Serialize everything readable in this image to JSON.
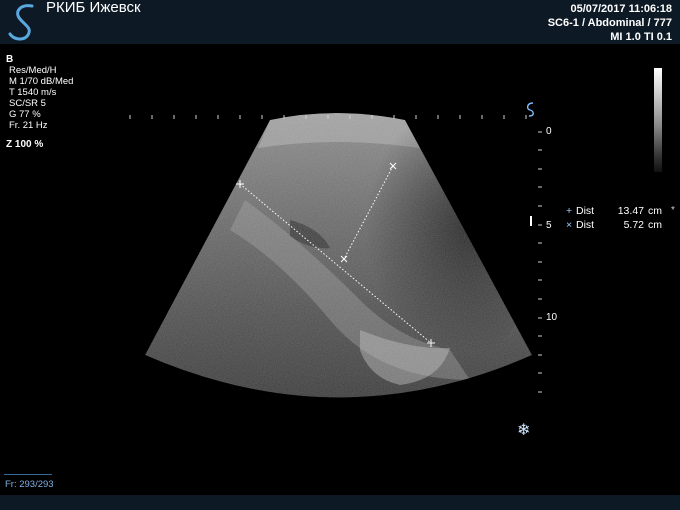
{
  "header": {
    "institution": "РКИБ Ижевск",
    "datetime": "05/07/2017 11:06:18",
    "probe_preset": "SC6-1 / Abdominal / 777",
    "index_readout": "MI 1.0  TI 0.1"
  },
  "params": {
    "mode": "B",
    "lines": [
      "Res/Med/H",
      "M 1/70 dB/Med",
      "T 1540 m/s",
      "SC/SR 5",
      "G 77 %",
      "Fr. 21 Hz"
    ],
    "zoom": "Z  100  %"
  },
  "depth_scale": {
    "labels": [
      "0",
      "5",
      "10"
    ],
    "unit": "cm"
  },
  "measurements": [
    {
      "symbol": "+",
      "label": "Dist",
      "value": "13.47",
      "unit": "cm"
    },
    {
      "symbol": "×",
      "label": "Dist",
      "value": "5.72",
      "unit": "cm"
    }
  ],
  "measurement_marker": "*",
  "footer": {
    "frame_counter": "Fr: 293/293"
  },
  "icons": {
    "logo": "s-curve-logo-icon",
    "freeze": "snowflake-icon",
    "orientation": "probe-orientation-icon"
  },
  "colors": {
    "topbar": "#0d1a25",
    "caliper": "#ffffff",
    "accent": "#9fd0ff"
  }
}
